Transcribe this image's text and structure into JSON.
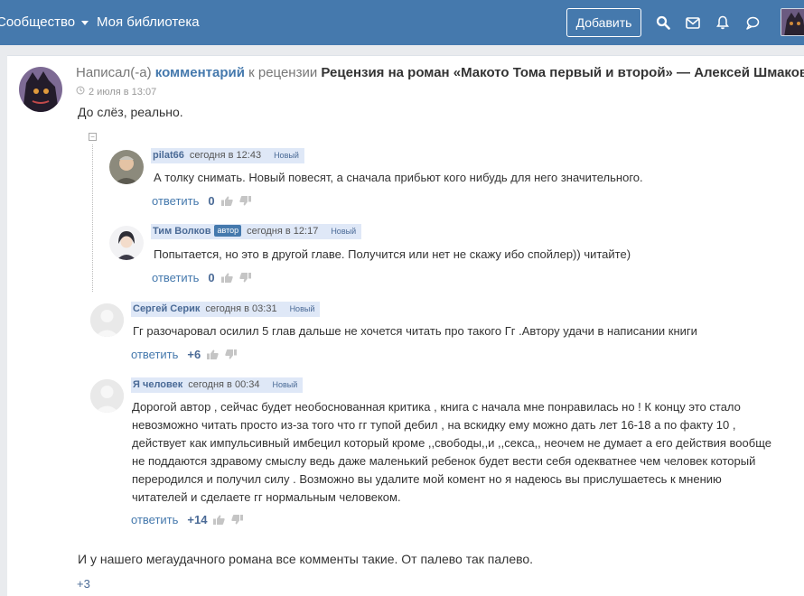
{
  "topbar": {
    "community": "Сообщество",
    "library": "Моя библиотека",
    "add_button": "Добавить",
    "icons": [
      "search-icon",
      "mail-icon",
      "bell-icon",
      "chat-icon"
    ]
  },
  "post": {
    "prefix": "Написал(-а)",
    "comment_link": "комментарий",
    "mid": "к рецензии",
    "review_title": "Рецензия на роман «Макото Тома первый и второй» — Алексей Шмаков",
    "time": "2 июля в 13:07",
    "text": "До слёз, реально."
  },
  "comments": [
    {
      "name": "pilat66",
      "time": "сегодня в 12:43",
      "badge": "Новый",
      "text": "А толку снимать. Новый повесят, а сначала прибьют кого нибудь для него значительного.",
      "reply": "ответить",
      "score": "0"
    },
    {
      "name": "Тим Волков",
      "author_badge": "автор",
      "time": "сегодня в 12:17",
      "badge": "Новый",
      "text": "Попытается, но это в другой главе. Получится или нет не скажу ибо спойлер)) читайте)",
      "reply": "ответить",
      "score": "0"
    },
    {
      "name": "Сергей Серик",
      "time": "сегодня в 03:31",
      "badge": "Новый",
      "text": "Гг разочаровал осилил 5 глав дальше не хочется читать про такого Гг .Автору удачи в написании книги",
      "reply": "ответить",
      "score": "+6"
    },
    {
      "name": "Я человек",
      "time": "сегодня в 00:34",
      "badge": "Новый",
      "lines": [
        "Дорогой автор , сейчас будет необоснованная критика , книга с начала мне понравилась но ! К концу это стало",
        "невозможно читать просто из-за того что гг тупой дебил , на вскидку ему можно дать лет 16-18 а по факту 10 ,",
        "действует как импульсивный имбецил который кроме ,,свободы,,и ,,секса,, неочем не думает а его действия вообще",
        "не поддаются здравому смыслу ведь даже маленький ребенок будет вести себя одекватнее чем человек который",
        "перeродился и получил силу . Возможно вы удалите мой комент но я надеюсь вы прислушаетесь к мнению",
        "читателей и сделаете гг нормальным человеком."
      ],
      "reply": "ответить",
      "score": "+14"
    }
  ],
  "bottom": {
    "text": "И у нашего мегаудачного романа все комменты такие. От палево так палево.",
    "score": "+3"
  }
}
